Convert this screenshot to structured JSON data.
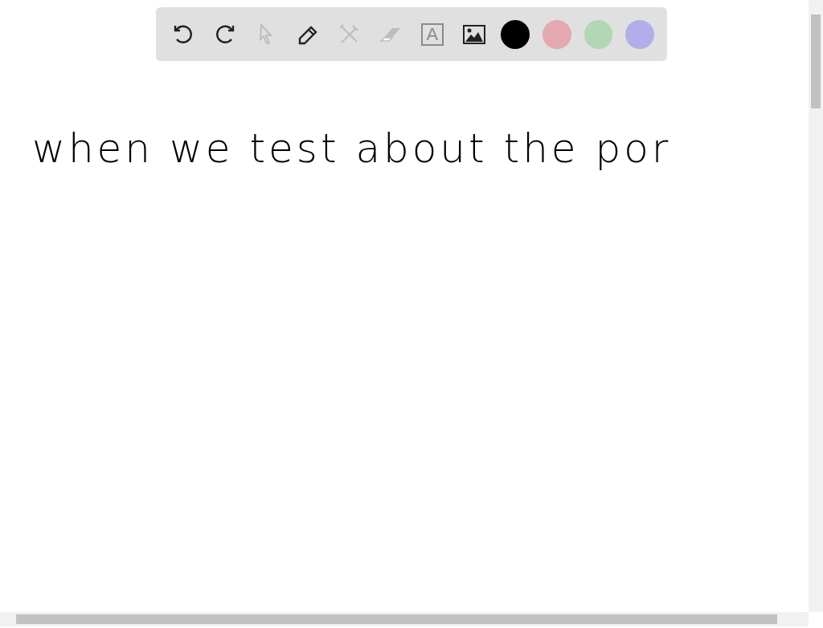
{
  "toolbar": {
    "tools": [
      {
        "kind": "undo",
        "disabled": false
      },
      {
        "kind": "redo",
        "disabled": false
      },
      {
        "kind": "select",
        "disabled": true
      },
      {
        "kind": "pen",
        "disabled": false
      },
      {
        "kind": "tools",
        "disabled": true
      },
      {
        "kind": "eraser",
        "disabled": true
      },
      {
        "kind": "text",
        "disabled": true,
        "glyph": "A"
      },
      {
        "kind": "image",
        "disabled": false
      }
    ],
    "colors": [
      {
        "color": "#000000"
      },
      {
        "color": "#e3a8b0"
      },
      {
        "color": "#b3d6b3"
      },
      {
        "color": "#b3aeea"
      }
    ]
  },
  "canvas": {
    "handwriting": "when we test about the por"
  }
}
